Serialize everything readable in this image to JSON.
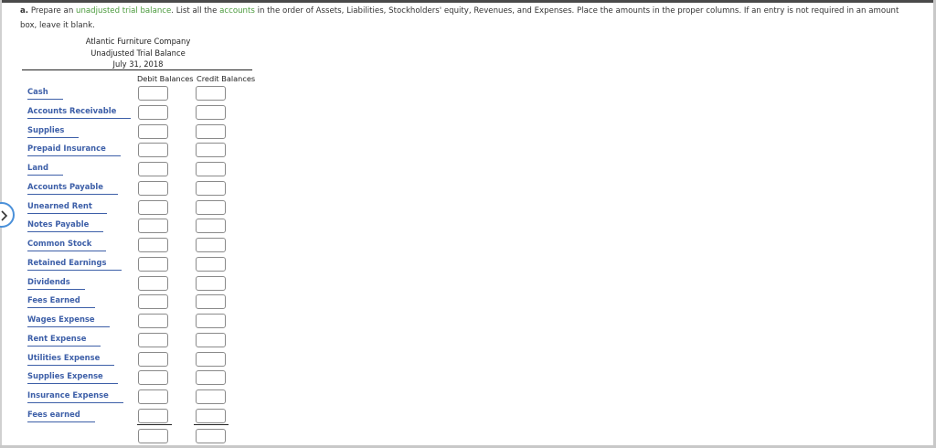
{
  "instructions": {
    "prefix": "a.",
    "text_1": "Prepare an",
    "link_1": "unadjusted trial balance",
    "text_2": ". List all the",
    "link_2": "accounts",
    "text_3": "in the order of Assets, Liabilities, Stockholders' equity, Revenues, and Expenses. Place the amounts in the proper columns. If an entry is not required in an amount box, leave it blank."
  },
  "header": {
    "company": "Atlantic Furniture Company",
    "statement": "Unadjusted Trial Balance",
    "date": "July 31, 2018"
  },
  "columns": {
    "debit": "Debit Balances",
    "credit": "Credit Balances"
  },
  "accounts": [
    {
      "name": "Cash",
      "debit": "",
      "credit": ""
    },
    {
      "name": "Accounts Receivable",
      "debit": "",
      "credit": ""
    },
    {
      "name": "Supplies",
      "debit": "",
      "credit": ""
    },
    {
      "name": "Prepaid Insurance",
      "debit": "",
      "credit": ""
    },
    {
      "name": "Land",
      "debit": "",
      "credit": ""
    },
    {
      "name": "Accounts Payable",
      "debit": "",
      "credit": ""
    },
    {
      "name": "Unearned Rent",
      "debit": "",
      "credit": ""
    },
    {
      "name": "Notes Payable",
      "debit": "",
      "credit": ""
    },
    {
      "name": "Common Stock",
      "debit": "",
      "credit": ""
    },
    {
      "name": "Retained Earnings",
      "debit": "",
      "credit": ""
    },
    {
      "name": "Dividends",
      "debit": "",
      "credit": ""
    },
    {
      "name": "Fees Earned",
      "debit": "",
      "credit": ""
    },
    {
      "name": "Wages Expense",
      "debit": "",
      "credit": ""
    },
    {
      "name": "Rent Expense",
      "debit": "",
      "credit": ""
    },
    {
      "name": "Utilities Expense",
      "debit": "",
      "credit": ""
    },
    {
      "name": "Supplies Expense",
      "debit": "",
      "credit": ""
    },
    {
      "name": "Insurance Expense",
      "debit": "",
      "credit": ""
    },
    {
      "name": "Fees earned",
      "debit": "",
      "credit": ""
    }
  ],
  "totals": {
    "debit": "",
    "credit": ""
  },
  "icons": {
    "nav": "chevron-right-icon"
  },
  "colors": {
    "link_green": "#4a9a3c",
    "account_blue": "#3d5fa8",
    "nav_blue": "#4a90d9"
  }
}
